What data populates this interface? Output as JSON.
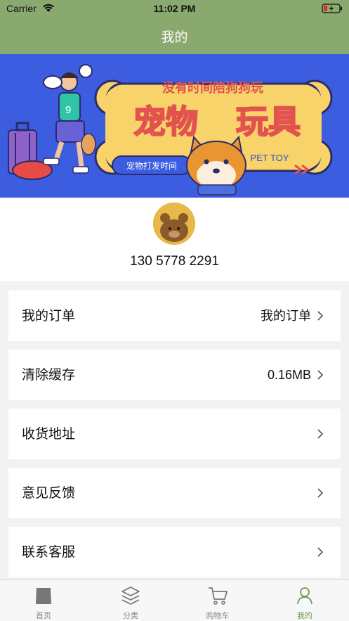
{
  "status_bar": {
    "carrier": "Carrier",
    "time": "11:02 PM"
  },
  "nav": {
    "title": "我的"
  },
  "banner": {
    "headline": "没有时间陪狗狗玩",
    "title_part1": "宠物",
    "title_part2": "玩具",
    "subtitle": "宠物打发时间",
    "tag": "PET TOY",
    "jersey_number": "9"
  },
  "profile": {
    "phone": "130 5778 2291"
  },
  "menu": [
    {
      "label": "我的订单",
      "value": "我的订单"
    },
    {
      "label": "清除缓存",
      "value": "0.16MB"
    },
    {
      "label": "收货地址",
      "value": ""
    },
    {
      "label": "意见反馈",
      "value": ""
    },
    {
      "label": "联系客服",
      "value": ""
    }
  ],
  "tabbar": {
    "items": [
      {
        "label": "首页",
        "icon": "home-icon"
      },
      {
        "label": "分类",
        "icon": "layers-icon"
      },
      {
        "label": "购物车",
        "icon": "cart-icon"
      },
      {
        "label": "我的",
        "icon": "profile-icon"
      }
    ],
    "active_index": 3,
    "active_color": "#6f9a52"
  },
  "colors": {
    "nav_bg": "#8aa96e",
    "banner_bg": "#3c5de0",
    "accent": "#6f9a52"
  }
}
